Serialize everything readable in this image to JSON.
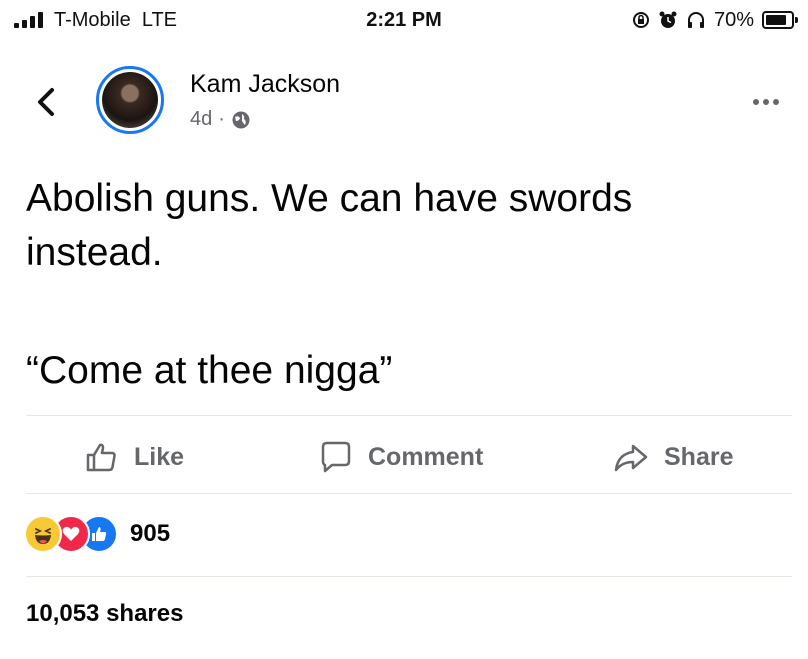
{
  "status_bar": {
    "carrier": "T-Mobile",
    "network": "LTE",
    "time": "2:21 PM",
    "battery": "70%",
    "icons": [
      "signal-icon",
      "screen-lock-icon",
      "alarm-icon",
      "headphones-icon",
      "battery-icon"
    ]
  },
  "post": {
    "author": "Kam Jackson",
    "age": "4d",
    "separator": "·",
    "audience_icon": "globe-icon",
    "text_line1": "Abolish guns. We can have swords instead.",
    "text_quote": "“Come at thee nigga”"
  },
  "actions": {
    "like": "Like",
    "comment": "Comment",
    "share": "Share"
  },
  "engagement": {
    "reaction_types": [
      "haha",
      "love",
      "like"
    ],
    "reaction_count": "905",
    "shares": "10,053 shares"
  },
  "colors": {
    "accent": "#1877f2",
    "secondary_text": "#65676b",
    "primary_text": "#050505"
  }
}
